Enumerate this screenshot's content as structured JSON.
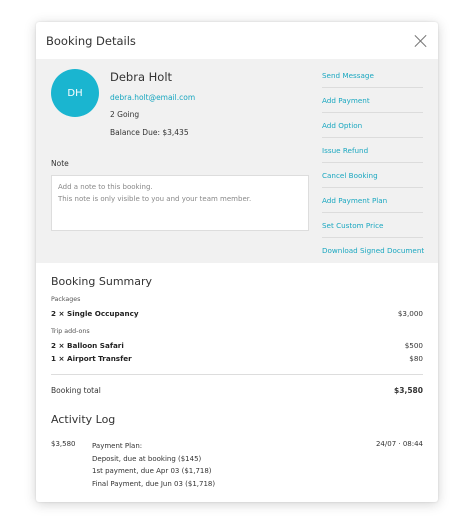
{
  "header": {
    "title": "Booking Details"
  },
  "customer": {
    "initials": "DH",
    "name": "Debra Holt",
    "email": "debra.holt@email.com",
    "going": "2 Going",
    "balance": "Balance Due: $3,435"
  },
  "note": {
    "label": "Note",
    "placeholder_line1": "Add a note to this booking.",
    "placeholder_line2": "This note is only visible to you and your team member."
  },
  "actions": [
    "Send Message",
    "Add Payment",
    "Add Option",
    "Issue Refund",
    "Cancel Booking",
    "Add Payment Plan",
    "Set Custom Price",
    "Download Signed Document"
  ],
  "summary": {
    "title": "Booking Summary",
    "packages_label": "Packages",
    "packages": [
      {
        "qty": "2 ×",
        "name": "Single Occupancy",
        "price": "$3,000"
      }
    ],
    "addons_label": "Trip add-ons",
    "addons": [
      {
        "qty": "2 ×",
        "name": "Balloon Safari",
        "price": "$500"
      },
      {
        "qty": "1 ×",
        "name": "Airport Transfer",
        "price": "$80"
      }
    ],
    "total_label": "Booking total",
    "total_value": "$3,580"
  },
  "activity": {
    "title": "Activity Log",
    "entries": [
      {
        "amount": "$3,580",
        "lines": [
          "Payment Plan:",
          "Deposit, due at booking ($145)",
          "1st payment, due Apr 03 ($1,718)",
          "Final Payment, due Jun 03 ($1,718)"
        ],
        "time": "24/07 · 08:44"
      }
    ]
  },
  "colors": {
    "accent": "#1ab5d0",
    "link": "#1aa7c0",
    "panel": "#f1f1f1"
  }
}
